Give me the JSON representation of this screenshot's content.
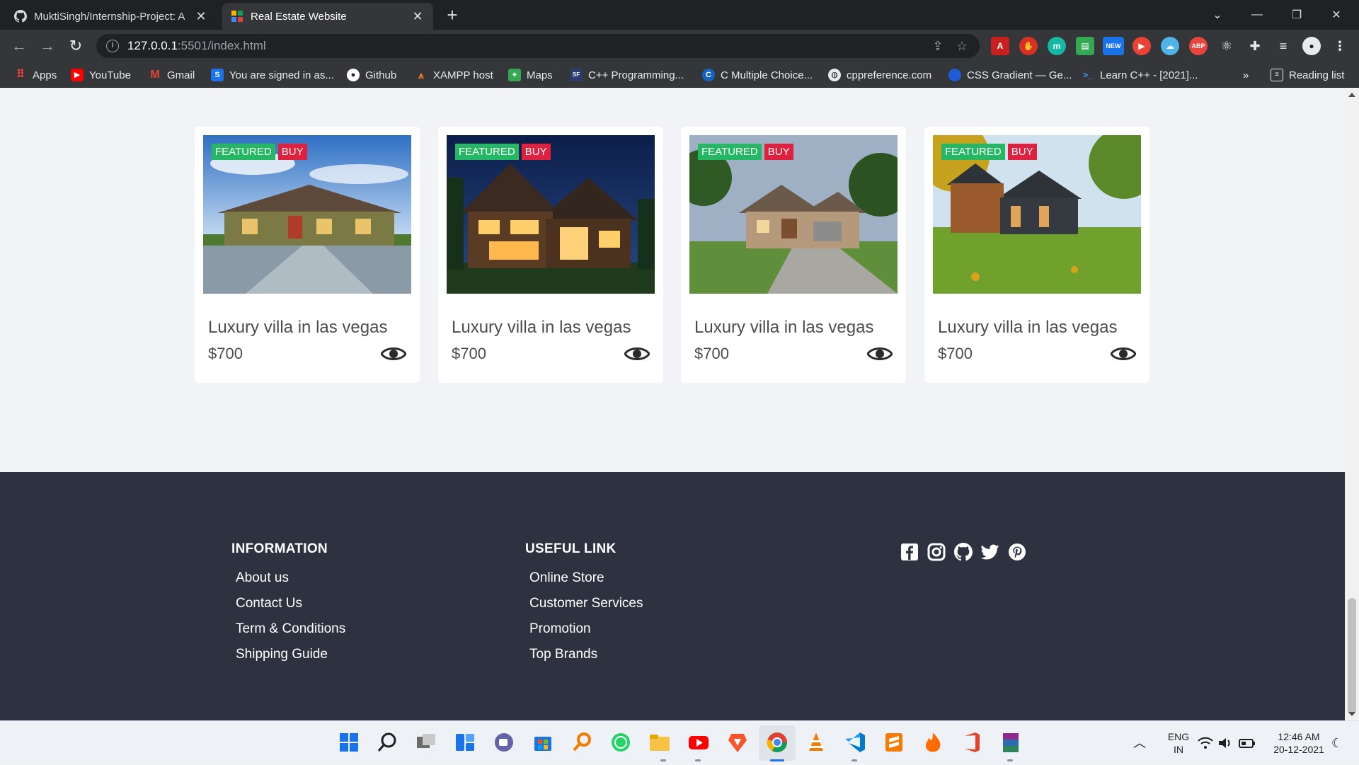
{
  "browser": {
    "tabs": [
      {
        "title": "MuktiSingh/Internship-Project: A",
        "icon": "github-icon",
        "active": false
      },
      {
        "title": "Real Estate Website",
        "icon": "site-favicon",
        "active": true
      }
    ],
    "url_host": "127.0.0.1",
    "url_path": ":5501/index.html",
    "bookmarks": [
      {
        "label": "Apps",
        "icon": "apps-grid-icon"
      },
      {
        "label": "YouTube",
        "icon": "youtube-icon"
      },
      {
        "label": "Gmail",
        "icon": "gmail-icon"
      },
      {
        "label": "You are signed in as...",
        "icon": "s-icon"
      },
      {
        "label": "Github",
        "icon": "github-icon"
      },
      {
        "label": "XAMPP host",
        "icon": "xampp-icon"
      },
      {
        "label": "Maps",
        "icon": "maps-icon"
      },
      {
        "label": "C++ Programming...",
        "icon": "cpp-icon"
      },
      {
        "label": "C Multiple Choice...",
        "icon": "c-icon"
      },
      {
        "label": "cppreference.com",
        "icon": "globe-icon"
      },
      {
        "label": "CSS Gradient — Ge...",
        "icon": "css-gradient-icon"
      },
      {
        "label": "Learn C++ - [2021]...",
        "icon": "terminal-icon"
      }
    ],
    "reading_list": "Reading list",
    "more_bookmarks": "»"
  },
  "listings": [
    {
      "name": "Luxury villa in las vegas",
      "price": "$700",
      "badge_featured": "FEATURED",
      "badge_buy": "BUY"
    },
    {
      "name": "Luxury villa in las vegas",
      "price": "$700",
      "badge_featured": "FEATURED",
      "badge_buy": "BUY"
    },
    {
      "name": "Luxury villa in las vegas",
      "price": "$700",
      "badge_featured": "FEATURED",
      "badge_buy": "BUY"
    },
    {
      "name": "Luxury villa in las vegas",
      "price": "$700",
      "badge_featured": "FEATURED",
      "badge_buy": "BUY"
    }
  ],
  "footer": {
    "information": {
      "heading": "INFORMATION",
      "links": [
        "About us",
        "Contact Us",
        "Term & Conditions",
        "Shipping Guide"
      ]
    },
    "useful": {
      "heading": "USEFUL LINK",
      "links": [
        "Online Store",
        "Customer Services",
        "Promotion",
        "Top Brands"
      ]
    },
    "social": [
      "facebook-icon",
      "instagram-icon",
      "github-icon",
      "twitter-icon",
      "pinterest-icon"
    ]
  },
  "taskbar": {
    "lang_top": "ENG",
    "lang_bottom": "IN",
    "time": "12:46 AM",
    "date": "20-12-2021"
  },
  "colors": {
    "featured": "#25b864",
    "buy": "#e0203f",
    "footer_bg": "#2d3140",
    "page_bg": "#f1f3f6"
  }
}
